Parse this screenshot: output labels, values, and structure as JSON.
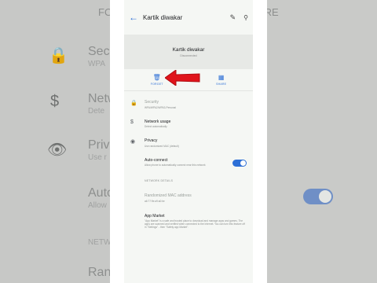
{
  "background": {
    "left_labels": [
      {
        "title": "Secu",
        "sub": "WPA",
        "icon": "lock-icon"
      },
      {
        "title": "Netw",
        "sub": "Dete",
        "icon": "dollar-icon"
      },
      {
        "title": "Priva",
        "sub": "Use r",
        "icon": "eye-icon"
      },
      {
        "title": "Auto",
        "sub": "Allow",
        "icon": ""
      },
      {
        "title": "NETW",
        "sub": "",
        "icon": ""
      },
      {
        "title": "Rand",
        "sub": "",
        "icon": ""
      }
    ],
    "top_left": "FO",
    "top_right": "ARE"
  },
  "appbar": {
    "back_icon": "←",
    "title": "Kartik diwakar",
    "edit_icon": "✎",
    "search_icon": "🔍"
  },
  "header": {
    "network_name": "Kartik diwakar",
    "status": "Disconnected"
  },
  "actions": {
    "forget_label": "FORGET",
    "share_label": "SHARE"
  },
  "rows": {
    "security": {
      "title": "Security",
      "subtitle": "WPA/WPA2/WPA3-Personal"
    },
    "network_usage": {
      "title": "Network usage",
      "subtitle": "Detect automatically"
    },
    "privacy": {
      "title": "Privacy",
      "subtitle": "Use randomized MAC (default)"
    },
    "auto_connect": {
      "title": "Auto-connect",
      "subtitle": "Allow phone to automatically connect near this network",
      "enabled": true
    }
  },
  "network_details": {
    "header": "NETWORK DETAILS",
    "mac": {
      "title": "Randomized MAC address",
      "value": "a6:77:9e:a9:a0:be"
    },
    "app_market": {
      "title": "App Market",
      "text": "\"App Market\" is a safe and trusted place to download and manage apps and games. The apps are scanned and verified when connected to the Internet. You can turn this feature off in \"Settings\" - then \"Safety app Market\"."
    }
  },
  "colors": {
    "accent": "#2d6fd6",
    "arrow": "#e0141b"
  }
}
